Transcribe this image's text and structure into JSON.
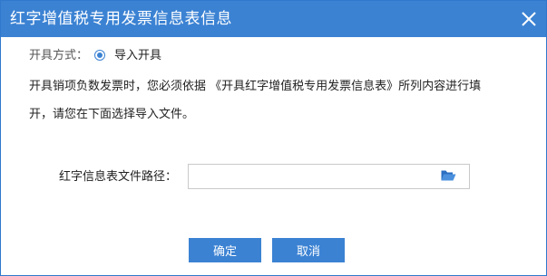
{
  "dialog": {
    "title": "红字增值税专用发票信息表信息",
    "close_icon": "close-icon"
  },
  "issue_mode": {
    "label": "开具方式：",
    "option_label": "导入开具",
    "selected": true
  },
  "notice": {
    "line1": "开具销项负数发票时，您必须依据 《开具红字增值税专用发票信息表》所列内容进行填",
    "line2": "开，请您在下面选择导入文件。"
  },
  "file_path": {
    "label": "红字信息表文件路径：",
    "value": "",
    "browse_icon": "folder-open-icon"
  },
  "buttons": {
    "confirm": "确定",
    "cancel": "取消"
  },
  "colors": {
    "titlebar": "#3b82d3",
    "button": "#3b82d3",
    "folder_icon": "#2a6fc2"
  }
}
